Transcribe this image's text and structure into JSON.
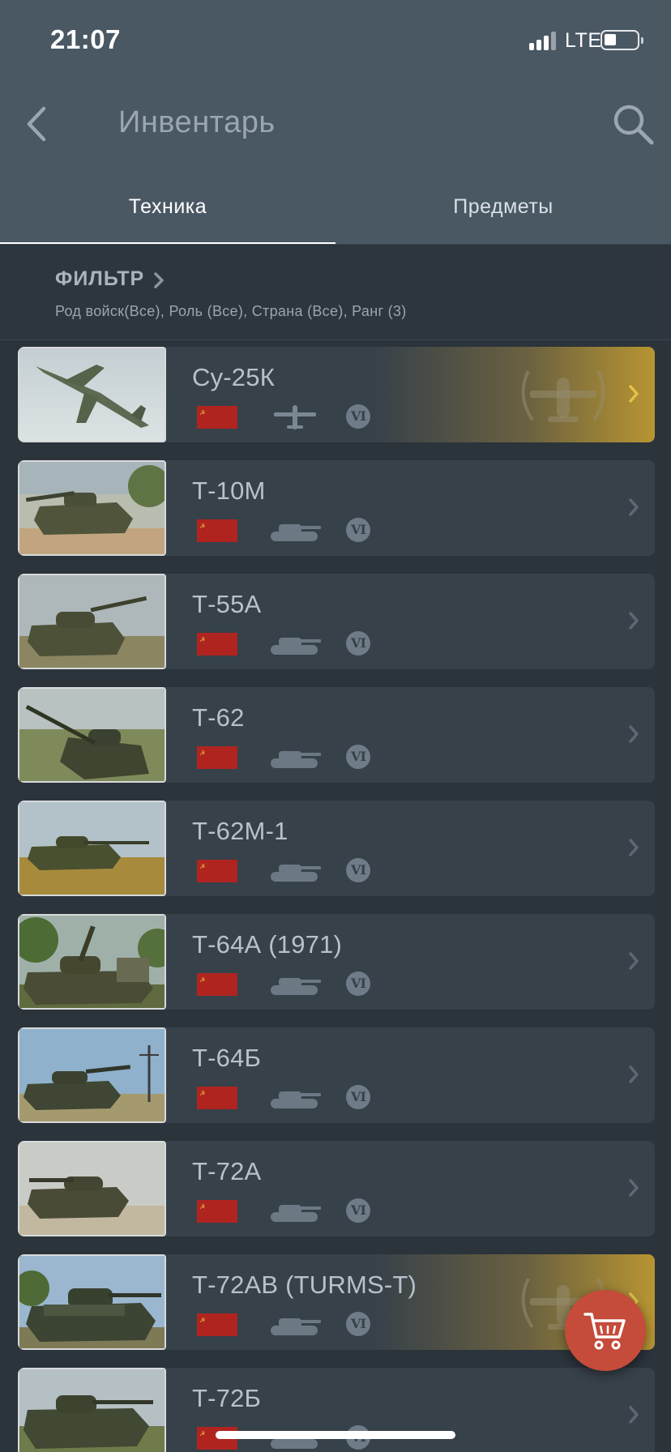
{
  "status_bar": {
    "time": "21:07",
    "network": "LTE"
  },
  "nav": {
    "title": "Инвентарь",
    "back_icon": "chevron-left-icon",
    "search_icon": "search-icon"
  },
  "tabs": [
    {
      "label": "Техника",
      "active": true
    },
    {
      "label": "Предметы",
      "active": false
    }
  ],
  "filter": {
    "title": "ФИЛЬТР",
    "summary": "Род войск(Все), Роль (Все), Страна (Все), Ранг (3)"
  },
  "vehicles": [
    {
      "name": "Су-25К",
      "type": "aircraft",
      "rank": "VI",
      "premium": true
    },
    {
      "name": "Т-10М",
      "type": "tank",
      "rank": "VI",
      "premium": false
    },
    {
      "name": "Т-55А",
      "type": "tank",
      "rank": "VI",
      "premium": false
    },
    {
      "name": "Т-62",
      "type": "tank",
      "rank": "VI",
      "premium": false
    },
    {
      "name": "Т-62М-1",
      "type": "tank",
      "rank": "VI",
      "premium": false
    },
    {
      "name": "Т-64А (1971)",
      "type": "tank",
      "rank": "VI",
      "premium": false
    },
    {
      "name": "Т-64Б",
      "type": "tank",
      "rank": "VI",
      "premium": false
    },
    {
      "name": "Т-72А",
      "type": "tank",
      "rank": "VI",
      "premium": false
    },
    {
      "name": "Т-72АВ (TURMS-T)",
      "type": "tank",
      "rank": "VI",
      "premium": true
    },
    {
      "name": "Т-72Б",
      "type": "tank",
      "rank": "VI",
      "premium": false
    }
  ],
  "colors": {
    "header_bg": "#4a5864",
    "card_bg": "#37414a",
    "premium_gold": "#b89532",
    "ussr_red": "#b02420",
    "cart_red": "#c54b3a"
  },
  "cart_icon": "shopping-cart-icon"
}
